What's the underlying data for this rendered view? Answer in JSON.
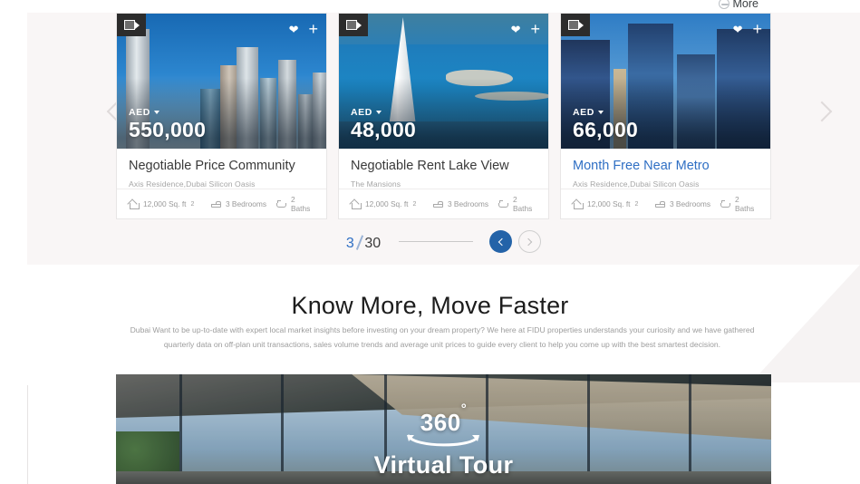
{
  "browser": {
    "more_label": "More"
  },
  "listings": {
    "cards": [
      {
        "badge_icon": "video-camera-icon",
        "currency": "AED",
        "price": "550,000",
        "title": "Negotiable Price Community",
        "subtitle": "Axis Residence,Dubai Silicon Oasis",
        "area": "12,000 Sq. ft",
        "area_sup": "2",
        "bedrooms": "3 Bedrooms",
        "baths": "2 Baths",
        "highlighted": false
      },
      {
        "badge_icon": "video-camera-icon",
        "currency": "AED",
        "price": "48,000",
        "title": "Negotiable Rent Lake View",
        "subtitle": "The Mansions",
        "area": "12,000 Sq. ft",
        "area_sup": "2",
        "bedrooms": "3 Bedrooms",
        "baths": "2 Baths",
        "highlighted": false
      },
      {
        "badge_icon": "video-camera-icon",
        "currency": "AED",
        "price": "66,000",
        "title": "Month Free Near Metro",
        "subtitle": "Axis Residence,Dubai Silicon Oasis",
        "area": "12,000 Sq. ft",
        "area_sup": "2",
        "bedrooms": "3 Bedrooms",
        "baths": "2 Baths",
        "highlighted": true
      }
    ],
    "pagination": {
      "current": "3",
      "total": "30",
      "prev_icon": "chevron-left-icon",
      "next_icon": "chevron-right-icon"
    },
    "nav": {
      "prev_icon": "chevron-left-icon",
      "next_icon": "chevron-right-icon"
    }
  },
  "know_more": {
    "title": "Know More, Move Faster",
    "paragraph": "Dubai Want to be up-to-date with expert local market insights before investing on your dream property? We here at FIDU properties understands your curiosity and we have gathered quarterly data on off-plan unit transactions, sales volume trends and average unit prices to guide every client to help you come up with the best smartest decision.",
    "tour": {
      "degrees": "360",
      "degree_symbol": "°",
      "label": "Virtual Tour"
    }
  },
  "colors": {
    "accent_blue": "#2f6fc4",
    "pagination_blue": "#2463a8",
    "band_background": "#f9f6f6",
    "muted_text": "#9d9d9d"
  }
}
